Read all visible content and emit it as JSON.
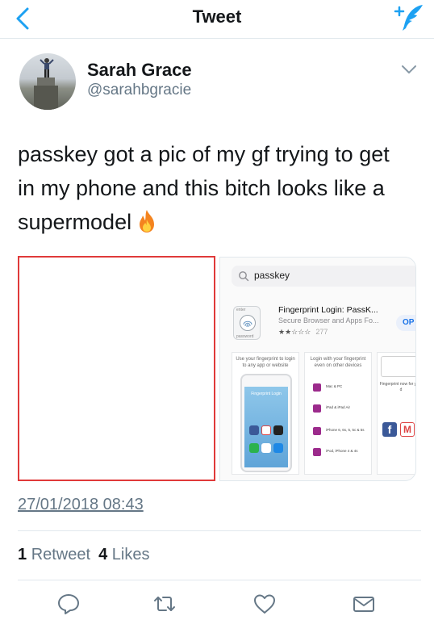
{
  "header": {
    "title": "Tweet"
  },
  "author": {
    "name": "Sarah Grace",
    "handle": "@sarahbgracie"
  },
  "tweet": {
    "text_line1": "passkey got a pic of my gf trying to get",
    "text_line2": "in my phone and this bitch looks like a",
    "text_line3": "supermodel"
  },
  "media": {
    "search_query": "passkey",
    "app_title": "Fingerprint Login: PassK...",
    "app_subtitle": "Secure Browser and Apps Fo...",
    "app_rating_stars": "★★☆☆☆",
    "app_rating_count": "277",
    "get_button": "OP",
    "icon_tag_top": "enter",
    "icon_tag_bottom": "password",
    "shot1_caption": "Use your fingerprint to login to any app or website",
    "shot1_phone_label": "Fingerprint Login",
    "shot2_caption": "Login with your fingerprint even on other devices",
    "shot2_devices": [
      "Mac & PC",
      "iPad & iPad Air",
      "iPhone 6, 6s, 5, 5c & 5s",
      "iPod, iPhone 4 & 4s"
    ],
    "shot3_caption": "Fingerprint now for your d",
    "shot3_fb": "f",
    "shot3_gm": "M"
  },
  "timestamp": "27/01/2018 08:43",
  "stats": {
    "retweets_count": "1",
    "retweets_label": "Retweet",
    "likes_count": "4",
    "likes_label": "Likes"
  },
  "colors": {
    "accent": "#1da1f2",
    "icon_gray": "#657786",
    "media_border": "#e03a3a"
  },
  "icons": {
    "back": "chevron-left-icon",
    "compose": "compose-tweet-icon",
    "caret": "chevron-down-icon",
    "fire": "fire-emoji-icon",
    "reply": "reply-icon",
    "retweet": "retweet-icon",
    "like": "heart-icon",
    "dm": "envelope-icon"
  }
}
